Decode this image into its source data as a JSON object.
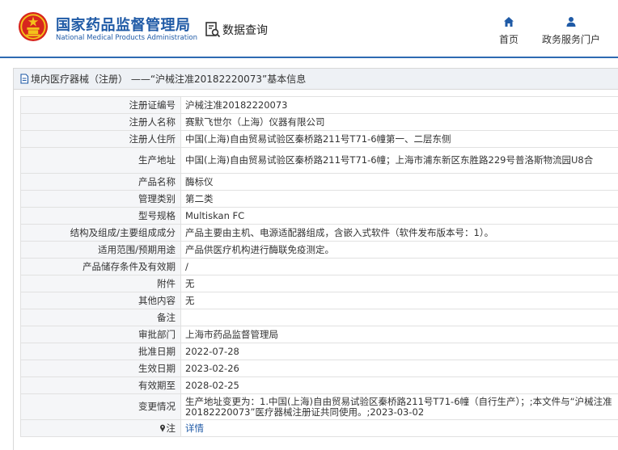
{
  "header": {
    "org_name_cn": "国家药品监督管理局",
    "org_name_en": "National Medical Products Administration",
    "query_label": "数据查询",
    "nav": [
      {
        "icon": "home-icon",
        "label": "首页"
      },
      {
        "icon": "user-icon",
        "label": "政务服务门户"
      }
    ]
  },
  "panel": {
    "title": "境内医疗器械（注册） ——“沪械注准20182220073”基本信息",
    "rows": [
      {
        "key": "注册证编号",
        "value": "沪械注准20182220073"
      },
      {
        "key": "注册人名称",
        "value": "赛默飞世尔（上海）仪器有限公司"
      },
      {
        "key": "注册人住所",
        "value": "中国(上海)自由贸易试验区秦桥路211号T71-6幢第一、二层东侧"
      },
      {
        "key": "生产地址",
        "value": "中国(上海)自由贸易试验区秦桥路211号T71-6幢；上海市浦东新区东胜路229号普洛斯物流园U8合"
      },
      {
        "key": "产品名称",
        "value": "酶标仪"
      },
      {
        "key": "管理类别",
        "value": "第二类"
      },
      {
        "key": "型号规格",
        "value": "Multiskan FC"
      },
      {
        "key": "结构及组成/主要组成成分",
        "value": "产品主要由主机、电源适配器组成，含嵌入式软件（软件发布版本号：1）。"
      },
      {
        "key": "适用范围/预期用途",
        "value": "产品供医疗机构进行酶联免疫测定。"
      },
      {
        "key": "产品储存条件及有效期",
        "value": "/"
      },
      {
        "key": "附件",
        "value": "无"
      },
      {
        "key": "其他内容",
        "value": "无"
      },
      {
        "key": "备注",
        "value": ""
      },
      {
        "key": "审批部门",
        "value": "上海市药品监督管理局"
      },
      {
        "key": "批准日期",
        "value": "2022-07-28"
      },
      {
        "key": "生效日期",
        "value": "2023-02-26"
      },
      {
        "key": "有效期至",
        "value": "2028-02-25"
      },
      {
        "key": "变更情况",
        "value": "生产地址变更为：1.中国(上海)自由贸易试验区秦桥路211号T71-6幢（自行生产）；;本文件与“沪械注准20182220073”医疗器械注册证共同使用。;2023-03-02"
      }
    ],
    "note_row": {
      "key": "注",
      "link": "详情"
    }
  }
}
